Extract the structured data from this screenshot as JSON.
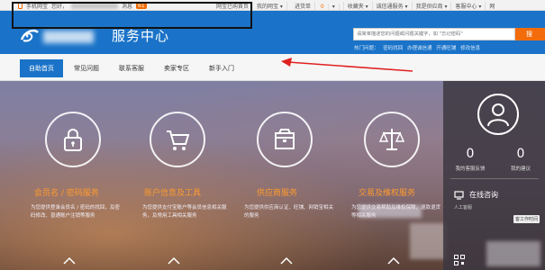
{
  "topbar": {
    "app_label": "手机网宝",
    "greeting": "您好，",
    "message_label": "消息",
    "message_count": "61",
    "right_links": [
      "网宝已购首页",
      "我的网宝 ▾",
      "进货单",
      "0",
      "▾",
      "收藏夹 ▾",
      "诚信通服务 ▾",
      "我是供应商 ▾",
      "客服中心 ▾",
      "网"
    ]
  },
  "header": {
    "title": "服务中心",
    "search_placeholder": "请简单描述您的问题或问题关键字，如 \"忘记密码\"",
    "search_button": "搜",
    "hot_label": "热门问题：",
    "hot_links": [
      "密码找回",
      "办理诚信通",
      "开通旺铺",
      "修改信息"
    ]
  },
  "nav": {
    "items": [
      "自助首页",
      "常见问题",
      "联系客服",
      "卖家专区",
      "新手入门"
    ],
    "active_index": 0
  },
  "cards": [
    {
      "title": "会员名 / 密码服务",
      "desc": "为您提供登录会员名 / 密码的找回，及密码修改、普通账户注销等服务",
      "icon": "lock-icon"
    },
    {
      "title": "账户信息及工具",
      "desc": "为您提供支付宝账户等会员信息相关服务，及常用工具相关服务",
      "icon": "cart-icon"
    },
    {
      "title": "供应商服务",
      "desc": "为您提供供应商认证、旺铺、网销宝相关的服务",
      "icon": "box-icon"
    },
    {
      "title": "交易及维权服务",
      "desc": "为您提供交易帮助及维权保障、退款退货等相关服务",
      "icon": "scales-icon"
    }
  ],
  "panel": {
    "stats": [
      {
        "value": "0",
        "label": "我的客服反馈"
      },
      {
        "value": "0",
        "label": "我的建议"
      }
    ],
    "consult_title": "在线咨询",
    "consult_sub": "人工客服",
    "consult_tag": "客工作时间"
  },
  "colors": {
    "brand_blue": "#1a73c8",
    "accent_orange": "#f36c0b",
    "card_title_orange": "#ff9b2e",
    "annotation_red": "#e02020"
  }
}
